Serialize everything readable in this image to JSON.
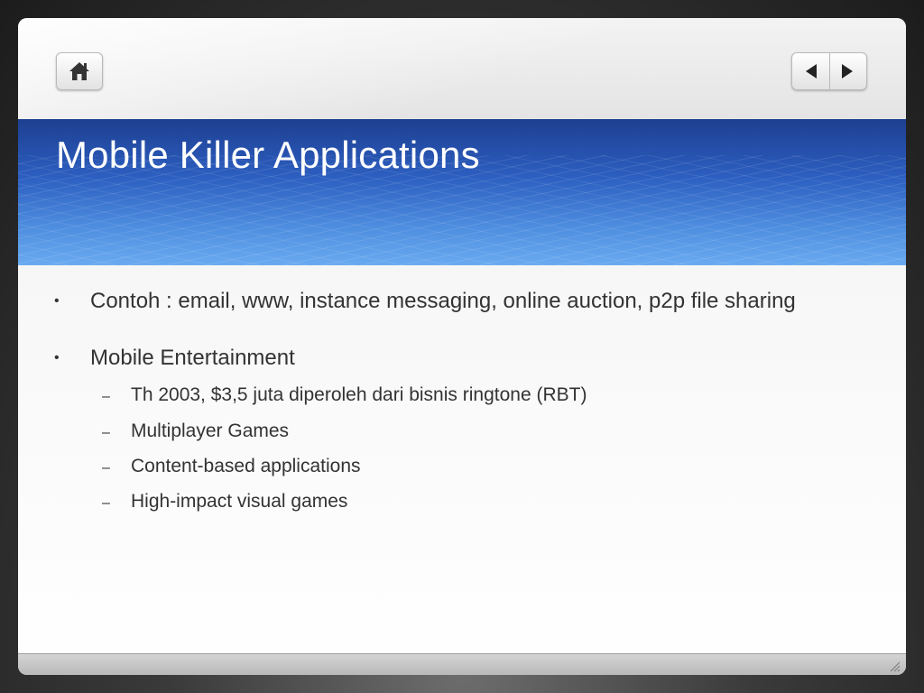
{
  "slide": {
    "title": "Mobile Killer Applications",
    "bullets": [
      {
        "marker": "•",
        "text": "Contoh : email, www, instance messaging, online auction, p2p file sharing",
        "sub_items": []
      },
      {
        "marker": "•",
        "text": "Mobile Entertainment",
        "sub_items": [
          {
            "marker": "–",
            "text": "Th 2003, $3,5 juta diperoleh dari bisnis ringtone (RBT)"
          },
          {
            "marker": "–",
            "text": "Multiplayer Games"
          },
          {
            "marker": "–",
            "text": "Content-based applications"
          },
          {
            "marker": "–",
            "text": "High-impact visual games"
          }
        ]
      }
    ]
  },
  "navigation": {
    "home_icon": "home-icon",
    "previous_icon": "triangle-left-icon",
    "next_icon": "triangle-right-icon"
  },
  "colors": {
    "title_band": "#2c5fc1",
    "title_text": "#ffffff",
    "body_text": "#333333"
  }
}
